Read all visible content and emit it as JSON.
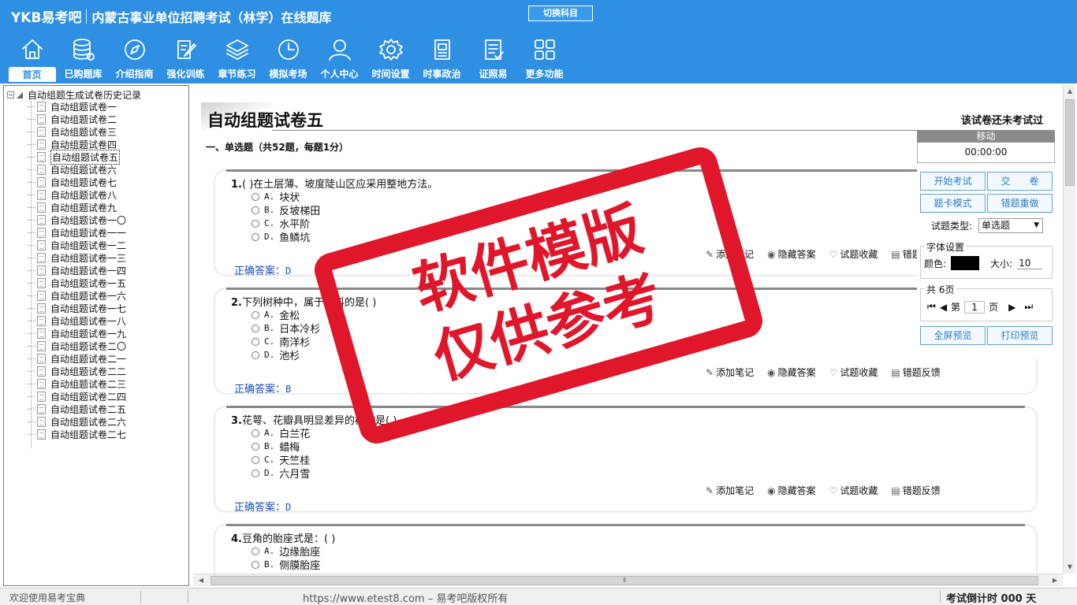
{
  "header": {
    "logo": "YKB易考吧",
    "title": "内蒙古事业单位招聘考试（林学）在线题库",
    "switch_subject": "切换科目",
    "nav": [
      {
        "label": "首页",
        "icon": "home-icon",
        "active": true
      },
      {
        "label": "已购题库",
        "icon": "database-icon"
      },
      {
        "label": "介绍指南",
        "icon": "compass-icon"
      },
      {
        "label": "强化训练",
        "icon": "edit-icon"
      },
      {
        "label": "章节练习",
        "icon": "layers-icon"
      },
      {
        "label": "模拟考场",
        "icon": "clock-icon"
      },
      {
        "label": "个人中心",
        "icon": "user-icon"
      },
      {
        "label": "时间设置",
        "icon": "gear-icon"
      },
      {
        "label": "时事政治",
        "icon": "news-icon"
      },
      {
        "label": "证照易",
        "icon": "checklist-icon"
      },
      {
        "label": "更多功能",
        "icon": "grid-icon"
      }
    ]
  },
  "tree": {
    "root": "自动组题生成试卷历史记录",
    "items": [
      "自动组题试卷一",
      "自动组题试卷二",
      "自动组题试卷三",
      "自动组题试卷四",
      "自动组题试卷五",
      "自动组题试卷六",
      "自动组题试卷七",
      "自动组题试卷八",
      "自动组题试卷九",
      "自动组题试卷一〇",
      "自动组题试卷一一",
      "自动组题试卷一二",
      "自动组题试卷一三",
      "自动组题试卷一四",
      "自动组题试卷一五",
      "自动组题试卷一六",
      "自动组题试卷一七",
      "自动组题试卷一八",
      "自动组题试卷一九",
      "自动组题试卷二〇",
      "自动组题试卷二一",
      "自动组题试卷二二",
      "自动组题试卷二三",
      "自动组题试卷二四",
      "自动组题试卷二五",
      "自动组题试卷二六",
      "自动组题试卷二七"
    ],
    "selected_index": 4
  },
  "paper": {
    "title": "自动组题试卷五",
    "status": "该试卷还未考试过",
    "section": "一、单选题（共52题，每题1分）"
  },
  "questions": [
    {
      "num": "1.",
      "stem": "( )在土层薄、坡度陡山区应采用整地方法。",
      "options": [
        [
          "A.",
          "块状"
        ],
        [
          "B.",
          "反坡梯田"
        ],
        [
          "C.",
          "水平阶"
        ],
        [
          "D.",
          "鱼鳞坑"
        ]
      ],
      "answer_label": "正确答案：",
      "answer": "D"
    },
    {
      "num": "2.",
      "stem": "下列树种中，属于松科的是( )",
      "options": [
        [
          "A.",
          "金松"
        ],
        [
          "B.",
          "日本冷杉"
        ],
        [
          "C.",
          "南洋杉"
        ],
        [
          "D.",
          "池杉"
        ]
      ],
      "answer_label": "正确答案：",
      "answer": "B"
    },
    {
      "num": "3.",
      "stem": "花萼、花瓣具明显差异的植物是( )。",
      "options": [
        [
          "A.",
          "白兰花"
        ],
        [
          "B.",
          "蜡梅"
        ],
        [
          "C.",
          "天竺桂"
        ],
        [
          "D.",
          "六月雪"
        ]
      ],
      "answer_label": "正确答案：",
      "answer": "D"
    },
    {
      "num": "4.",
      "stem": "豆角的胎座式是：( )",
      "options": [
        [
          "A.",
          "边缘胎座"
        ],
        [
          "B.",
          "侧膜胎座"
        ]
      ],
      "answer_label": "",
      "answer": ""
    }
  ],
  "actions": {
    "add_note": "添加笔记",
    "hide_answer": "隐藏答案",
    "favorite": "试题收藏",
    "feedback": "错题反馈"
  },
  "panel": {
    "move": "移动",
    "timer": "00:00:00",
    "start_exam": "开始考试",
    "submit": "交　　卷",
    "card_mode": "题卡模式",
    "redo_wrong": "错题重做",
    "type_label": "试题类型:",
    "type_value": "单选题",
    "font_legend": "字体设置",
    "color_label": "颜色:",
    "color_value": "#000000",
    "size_label": "大小:",
    "size_value": "10",
    "pages_legend": "共 6页",
    "page_prefix": "第",
    "page_value": "1",
    "page_suffix": "页",
    "fullscreen": "全屏预览",
    "print": "打印预览"
  },
  "status": {
    "welcome": "欢迎使用易考宝典",
    "url": "https://www.etest8.com – 易考吧版权所有",
    "countdown": "考试倒计时 000 天"
  },
  "watermark": {
    "line1": "软件模版",
    "line2": "仅供参考"
  },
  "colors": {
    "header": "#2e8fe3",
    "stamp": "#e0162b",
    "answer": "#1a4fb5"
  }
}
